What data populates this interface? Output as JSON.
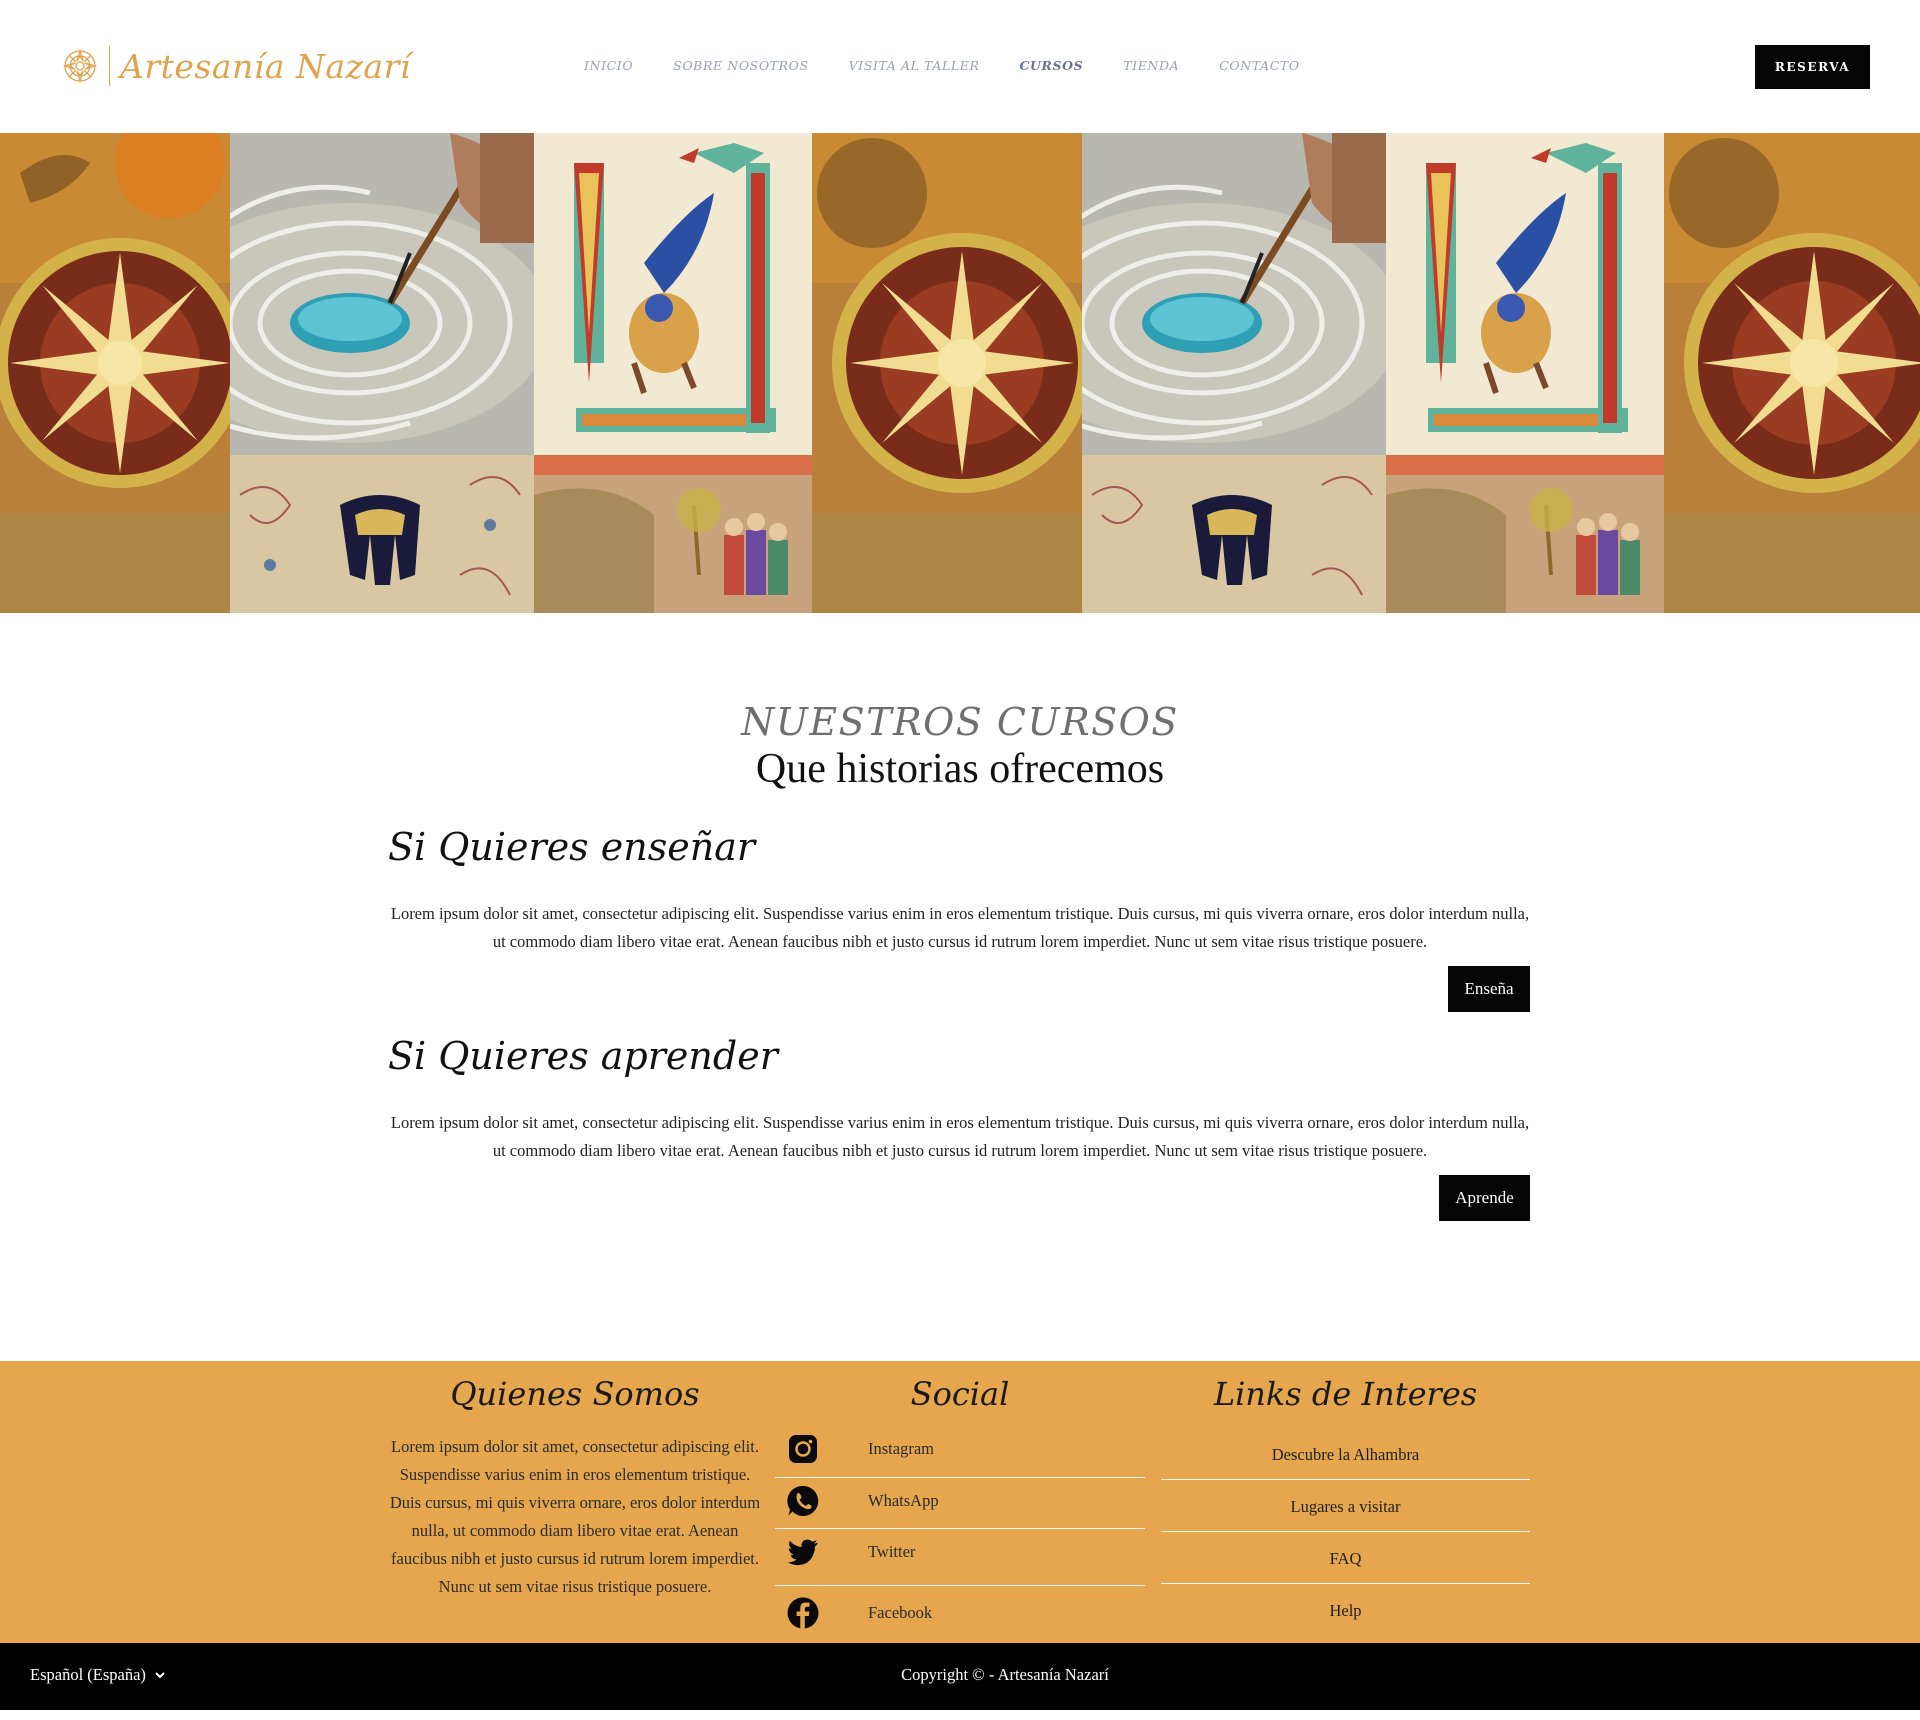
{
  "header": {
    "logo_text": "Artesanía Nazarí",
    "nav": [
      "INICIO",
      "SOBRE NOSOTROS",
      "VISITA AL TALLER",
      "CURSOS",
      "TIENDA",
      "CONTACTO"
    ],
    "active_nav": "CURSOS",
    "reserve_label": "RESERVA"
  },
  "courses": {
    "kicker": "NUESTROS CURSOS",
    "title": "Que historias ofrecemos",
    "items": [
      {
        "heading": "Si Quieres enseñar",
        "text": "Lorem ipsum dolor sit amet, consectetur adipiscing elit. Suspendisse varius enim in eros elementum tristique. Duis cursus, mi quis viverra ornare, eros dolor interdum nulla, ut commodo diam libero vitae erat. Aenean faucibus nibh et justo cursus id rutrum lorem imperdiet. Nunc ut sem vitae risus tristique posuere.",
        "button": "Enseña"
      },
      {
        "heading": "Si Quieres aprender",
        "text": "Lorem ipsum dolor sit amet, consectetur adipiscing elit. Suspendisse varius enim in eros elementum tristique. Duis cursus, mi quis viverra ornare, eros dolor interdum nulla, ut commodo diam libero vitae erat. Aenean faucibus nibh et justo cursus id rutrum lorem imperdiet. Nunc ut sem vitae risus tristique posuere.",
        "button": "Aprende"
      }
    ]
  },
  "footer": {
    "about_title": "Quienes Somos",
    "about_text": "Lorem ipsum dolor sit amet, consectetur adipiscing elit. Suspendisse varius enim in eros elementum tristique. Duis cursus, mi quis viverra ornare, eros dolor interdum nulla, ut commodo diam libero vitae erat. Aenean faucibus nibh et justo cursus id rutrum lorem imperdiet. Nunc ut sem vitae risus tristique posuere.",
    "social_title": "Social",
    "social": [
      {
        "label": "Instagram",
        "icon": "instagram-icon"
      },
      {
        "label": "WhatsApp",
        "icon": "whatsapp-icon"
      },
      {
        "label": "Twitter",
        "icon": "twitter-icon"
      },
      {
        "label": "Facebook",
        "icon": "facebook-icon"
      }
    ],
    "links_title": "Links de Interes",
    "links": [
      "Descubre la Alhambra",
      "Lugares a visitar",
      "FAQ",
      "Help"
    ],
    "language": "Español (España)",
    "copyright": "Copyright © - Artesanía Nazarí"
  },
  "colors": {
    "accent": "#e5a64d",
    "logo": "#e0a24b",
    "nav": "#9aa0b4",
    "button": "#050505"
  }
}
